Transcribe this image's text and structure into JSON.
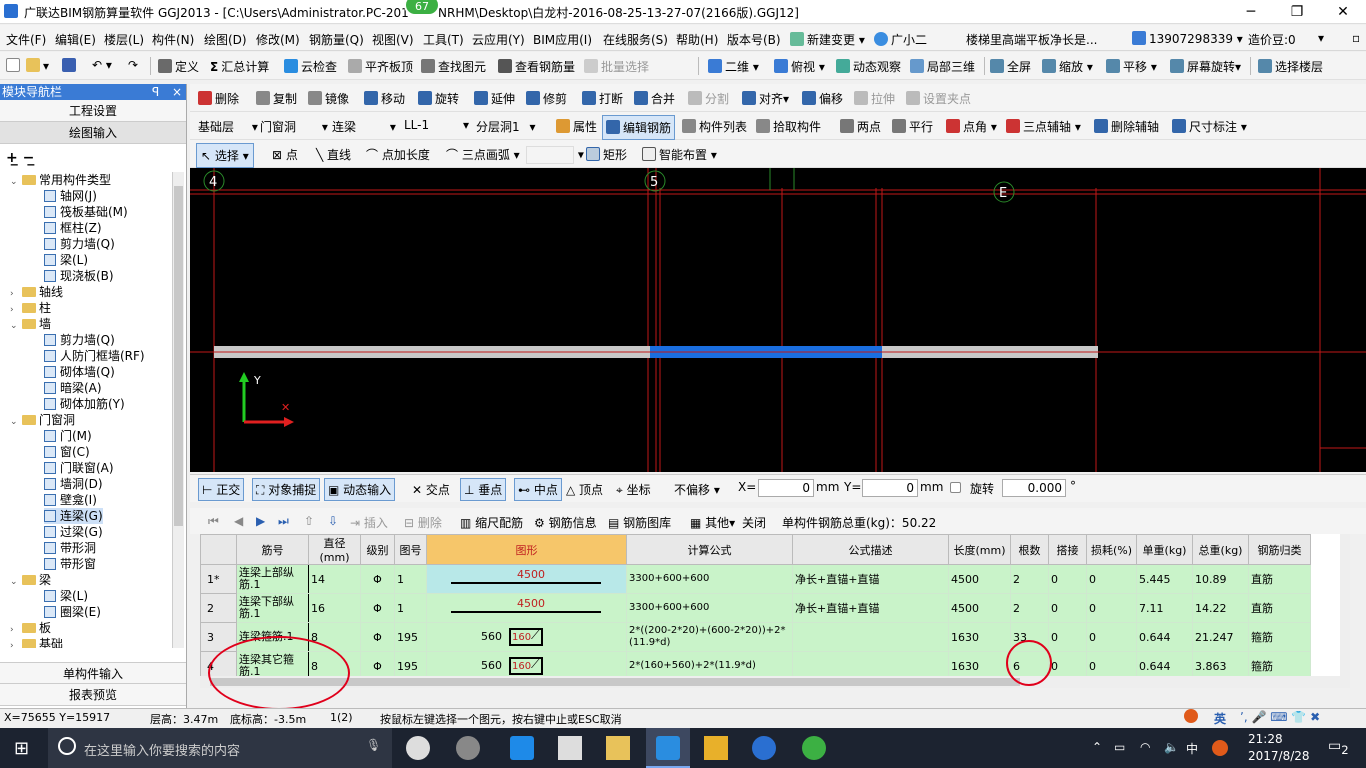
{
  "titlebar": {
    "title": "广联达BIM钢筋算量软件 GGJ2013 - [C:\\Users\\Administrator.PC-201",
    "title2": "NRHM\\Desktop\\白龙村-2016-08-25-13-27-07(2166版).GGJ12]",
    "badge": "67"
  },
  "menu": [
    "文件(F)",
    "编辑(E)",
    "楼层(L)",
    "构件(N)",
    "绘图(D)",
    "修改(M)",
    "钢筋量(Q)",
    "视图(V)",
    "工具(T)",
    "云应用(Y)",
    "BIM应用(I)",
    "在线服务(S)",
    "帮助(H)",
    "版本号(B)",
    "新建变更",
    "广小二"
  ],
  "menu_right": {
    "notice": "楼梯里高端平板净长是...",
    "phone": "13907298339",
    "beans": "造价豆:0"
  },
  "toolbar1": [
    "定义",
    "汇总计算",
    "云检查",
    "平齐板顶",
    "查找图元",
    "查看钢筋量",
    "批量选择",
    "二维",
    "俯视",
    "动态观察",
    "局部三维",
    "全屏",
    "缩放",
    "平移",
    "屏幕旋转",
    "选择楼层"
  ],
  "toolbar2": [
    "删除",
    "复制",
    "镜像",
    "移动",
    "旋转",
    "延伸",
    "修剪",
    "打断",
    "合并",
    "分割",
    "对齐",
    "偏移",
    "拉伸",
    "设置夹点"
  ],
  "toolbar3": {
    "floor": "基础层",
    "category": "门窗洞",
    "type": "连梁",
    "name": "LL-1",
    "layer": "分层洞1",
    "items": [
      "属性",
      "编辑钢筋",
      "构件列表",
      "拾取构件",
      "两点",
      "平行",
      "点角",
      "三点辅轴",
      "删除辅轴",
      "尺寸标注"
    ]
  },
  "toolbar4": [
    "选择",
    "点",
    "直线",
    "点加长度",
    "三点画弧",
    "矩形",
    "智能布置"
  ],
  "leftpanel": {
    "title": "模块导航栏",
    "pin": "ᵖ",
    "close": "×",
    "btn1": "工程设置",
    "btn2": "绘图输入",
    "btn3": "单构件输入",
    "btn4": "报表预览",
    "tree": [
      {
        "lvl": 0,
        "exp": "⌄",
        "fold": true,
        "label": "常用构件类型"
      },
      {
        "lvl": 2,
        "label": "轴网(J)"
      },
      {
        "lvl": 2,
        "label": "筏板基础(M)"
      },
      {
        "lvl": 2,
        "label": "框柱(Z)"
      },
      {
        "lvl": 2,
        "label": "剪力墙(Q)"
      },
      {
        "lvl": 2,
        "label": "梁(L)"
      },
      {
        "lvl": 2,
        "label": "现浇板(B)"
      },
      {
        "lvl": 0,
        "exp": "›",
        "fold": true,
        "label": "轴线"
      },
      {
        "lvl": 0,
        "exp": "›",
        "fold": true,
        "label": "柱"
      },
      {
        "lvl": 0,
        "exp": "⌄",
        "fold": true,
        "label": "墙"
      },
      {
        "lvl": 2,
        "label": "剪力墙(Q)"
      },
      {
        "lvl": 2,
        "label": "人防门框墙(RF)"
      },
      {
        "lvl": 2,
        "label": "砌体墙(Q)"
      },
      {
        "lvl": 2,
        "label": "暗梁(A)"
      },
      {
        "lvl": 2,
        "label": "砌体加筋(Y)"
      },
      {
        "lvl": 0,
        "exp": "⌄",
        "fold": true,
        "label": "门窗洞"
      },
      {
        "lvl": 2,
        "label": "门(M)"
      },
      {
        "lvl": 2,
        "label": "窗(C)"
      },
      {
        "lvl": 2,
        "label": "门联窗(A)"
      },
      {
        "lvl": 2,
        "label": "墙洞(D)"
      },
      {
        "lvl": 2,
        "label": "壁龛(I)"
      },
      {
        "lvl": 2,
        "label": "连梁(G)",
        "sel": true
      },
      {
        "lvl": 2,
        "label": "过梁(G)"
      },
      {
        "lvl": 2,
        "label": "带形洞"
      },
      {
        "lvl": 2,
        "label": "带形窗"
      },
      {
        "lvl": 0,
        "exp": "⌄",
        "fold": true,
        "label": "梁"
      },
      {
        "lvl": 2,
        "label": "梁(L)"
      },
      {
        "lvl": 2,
        "label": "圈梁(E)"
      },
      {
        "lvl": 0,
        "exp": "›",
        "fold": true,
        "label": "板"
      },
      {
        "lvl": 0,
        "exp": "›",
        "fold": true,
        "label": "基础"
      }
    ]
  },
  "canvas": {
    "axis4": "4",
    "axis5": "5",
    "axisE": "E",
    "ylabel": "Y"
  },
  "snapbar": {
    "items": [
      "正交",
      "对象捕捉",
      "动态输入",
      "交点",
      "垂点",
      "中点",
      "顶点",
      "坐标"
    ],
    "offset": "不偏移",
    "x_label": "X=",
    "x_val": "0",
    "y_label": "Y=",
    "y_val": "0",
    "mm": "mm",
    "rotate_label": "旋转",
    "rotate_val": "0.000",
    "deg": "°"
  },
  "gridbar": {
    "items": [
      "插入",
      "删除",
      "缩尺配筋",
      "钢筋信息",
      "钢筋图库",
      "其他",
      "关闭"
    ],
    "total": "单构件钢筋总重(kg)：50.22"
  },
  "table": {
    "headers": [
      "筋号",
      "直径(mm)",
      "级别",
      "图号",
      "图形",
      "计算公式",
      "公式描述",
      "长度(mm)",
      "根数",
      "搭接",
      "损耗(%)",
      "单重(kg)",
      "总重(kg)",
      "钢筋归类"
    ],
    "rows": [
      {
        "rn": "1*",
        "name": "连梁上部纵筋.1",
        "dia": "14",
        "grade": "Φ",
        "fig": "1",
        "shape": "4500",
        "formula": "3300+600+600",
        "desc": "净长+直锚+直锚",
        "len": "4500",
        "num": "2",
        "lap": "0",
        "loss": "0",
        "unit": "5.445",
        "total": "10.89",
        "cat": "直筋"
      },
      {
        "rn": "2",
        "name": "连梁下部纵筋.1",
        "dia": "16",
        "grade": "Φ",
        "fig": "1",
        "shape": "4500",
        "formula": "3300+600+600",
        "desc": "净长+直锚+直锚",
        "len": "4500",
        "num": "2",
        "lap": "0",
        "loss": "0",
        "unit": "7.11",
        "total": "14.22",
        "cat": "直筋"
      },
      {
        "rn": "3",
        "name": "连梁箍筋.1",
        "dia": "8",
        "grade": "Φ",
        "fig": "195",
        "shape_a": "560",
        "shape_b": "160",
        "formula": "2*((200-2*20)+(600-2*20))+2*(11.9*d)",
        "desc": "",
        "len": "1630",
        "num": "33",
        "lap": "0",
        "loss": "0",
        "unit": "0.644",
        "total": "21.247",
        "cat": "箍筋"
      },
      {
        "rn": "4",
        "name": "连梁其它箍筋.1",
        "dia": "8",
        "grade": "Φ",
        "fig": "195",
        "shape_a": "560",
        "shape_b": "160",
        "formula": "2*(160+560)+2*(11.9*d)",
        "desc": "",
        "len": "1630",
        "num": "6",
        "lap": "0",
        "loss": "0",
        "unit": "0.644",
        "total": "3.863",
        "cat": "箍筋"
      }
    ]
  },
  "bottombar": {
    "coords": "X=75655 Y=15917",
    "height": "层高：3.47m",
    "base": "底标高：-3.5m",
    "count": "1(2)",
    "hint": "按鼠标左键选择一个图元，按右键中止或ESC取消",
    "ime": "英"
  },
  "taskbar": {
    "search": "在这里输入你要搜索的内容",
    "time": "21:28",
    "date": "2017/8/28",
    "lang": "中",
    "notif": "2"
  }
}
